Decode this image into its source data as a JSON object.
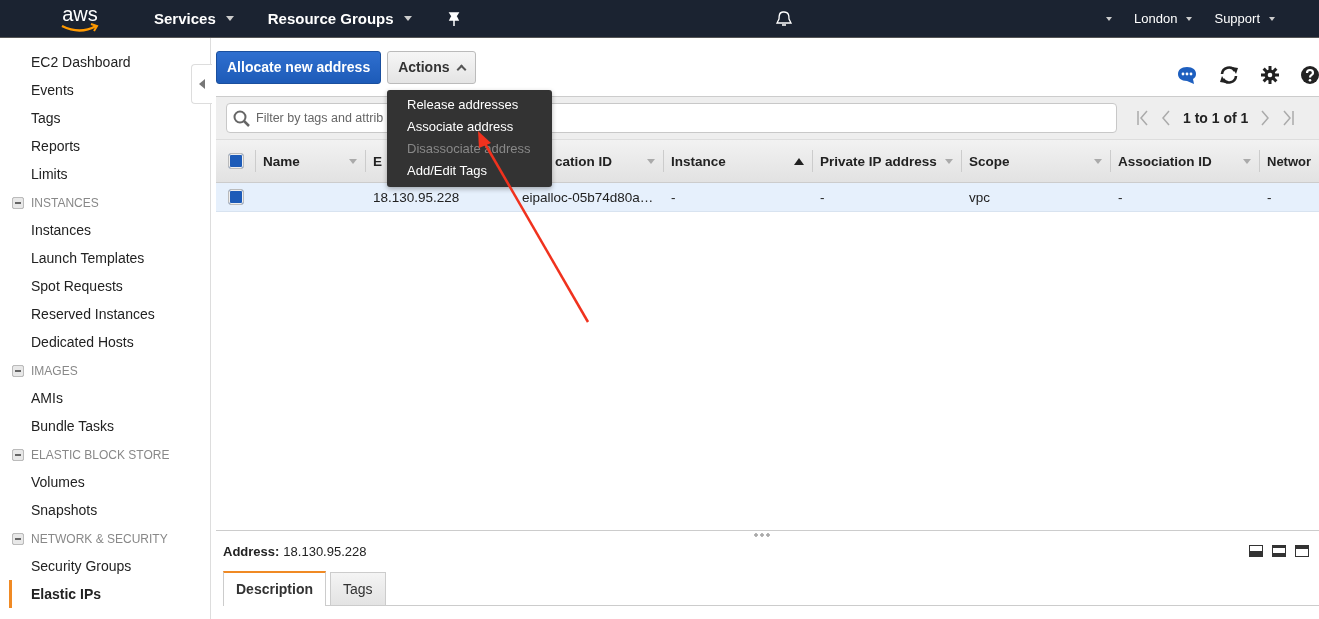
{
  "nav": {
    "logo": "aws",
    "menus": [
      {
        "label": "Services"
      },
      {
        "label": "Resource Groups"
      }
    ],
    "right_menus": [
      {
        "label": "London"
      },
      {
        "label": "Support"
      }
    ]
  },
  "sidebar": {
    "sections": [
      {
        "items": [
          {
            "label": "EC2 Dashboard",
            "selected": false
          },
          {
            "label": "Events",
            "selected": false
          },
          {
            "label": "Tags",
            "selected": false
          },
          {
            "label": "Reports",
            "selected": false
          },
          {
            "label": "Limits",
            "selected": false
          }
        ]
      },
      {
        "heading": "INSTANCES",
        "expanded": true,
        "items": [
          {
            "label": "Instances",
            "selected": false
          },
          {
            "label": "Launch Templates",
            "selected": false
          },
          {
            "label": "Spot Requests",
            "selected": false
          },
          {
            "label": "Reserved Instances",
            "selected": false
          },
          {
            "label": "Dedicated Hosts",
            "selected": false
          }
        ]
      },
      {
        "heading": "IMAGES",
        "expanded": true,
        "items": [
          {
            "label": "AMIs",
            "selected": false
          },
          {
            "label": "Bundle Tasks",
            "selected": false
          }
        ]
      },
      {
        "heading": "ELASTIC BLOCK STORE",
        "expanded": true,
        "items": [
          {
            "label": "Volumes",
            "selected": false
          },
          {
            "label": "Snapshots",
            "selected": false
          }
        ]
      },
      {
        "heading": "NETWORK & SECURITY",
        "expanded": true,
        "items": [
          {
            "label": "Security Groups",
            "selected": false
          },
          {
            "label": "Elastic IPs",
            "selected": true
          }
        ]
      }
    ]
  },
  "toolbar": {
    "primary_button": "Allocate new address",
    "actions_button": {
      "label": "Actions",
      "expanded": true
    }
  },
  "actions_menu": [
    {
      "label": "Release addresses",
      "disabled": false
    },
    {
      "label": "Associate address",
      "disabled": false
    },
    {
      "label": "Disassociate address",
      "disabled": true
    },
    {
      "label": "Add/Edit Tags",
      "disabled": false
    }
  ],
  "filter": {
    "placeholder": "Filter by tags and attrib"
  },
  "pagination": "1 to 1 of 1",
  "table": {
    "all_checked": true,
    "columns": [
      {
        "label": "Name",
        "sorted": false,
        "kind": "full"
      },
      {
        "label": "E",
        "sorted": false,
        "kind": "head"
      },
      {
        "label": "cation ID",
        "sorted": false,
        "kind": "tail"
      },
      {
        "label": "Instance",
        "sorted": true,
        "kind": "full"
      },
      {
        "label": "Private IP address",
        "sorted": false,
        "kind": "full"
      },
      {
        "label": "Scope",
        "sorted": false,
        "kind": "full"
      },
      {
        "label": "Association ID",
        "sorted": false,
        "kind": "full"
      },
      {
        "label": "Networ",
        "kind": "head"
      }
    ],
    "rows": [
      {
        "checked": true,
        "selected": true,
        "cells": [
          null,
          "18.130.95.228",
          "eipalloc-05b74d80a…",
          "-",
          "-",
          "vpc",
          "-",
          "-"
        ]
      }
    ]
  },
  "details": {
    "label": "Address:",
    "value": "18.130.95.228",
    "tabs": [
      {
        "label": "Description",
        "selected": true
      },
      {
        "label": "Tags",
        "selected": false
      }
    ]
  }
}
